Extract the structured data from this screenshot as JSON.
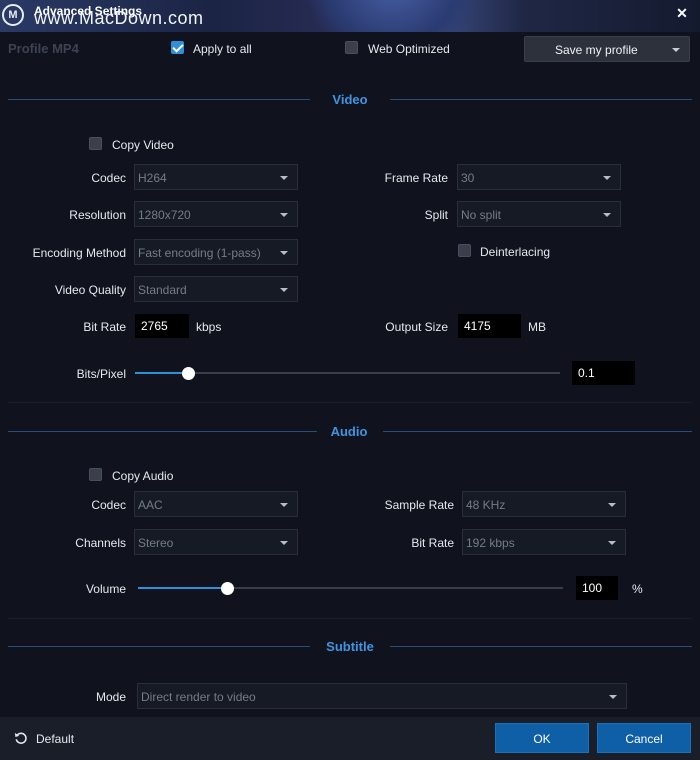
{
  "window": {
    "title": "Advanced Settings",
    "watermark": "www.MacDown.com",
    "logo_letter": "M",
    "close_glyph": "✕"
  },
  "header": {
    "profile_label": "Profile  MP4",
    "apply_to_all": {
      "label": "Apply to all",
      "checked": true
    },
    "web_optimized": {
      "label": "Web Optimized",
      "checked": false
    },
    "save_profile": {
      "label": "Save my profile"
    }
  },
  "video": {
    "title": "Video",
    "copy_video": {
      "label": "Copy Video",
      "checked": false
    },
    "codec": {
      "label": "Codec",
      "value": "H264"
    },
    "frame_rate": {
      "label": "Frame Rate",
      "value": "30"
    },
    "resolution": {
      "label": "Resolution",
      "value": "1280x720"
    },
    "split": {
      "label": "Split",
      "value": "No split"
    },
    "encoding_method": {
      "label": "Encoding Method",
      "value": "Fast encoding (1-pass)"
    },
    "deinterlacing": {
      "label": "Deinterlacing",
      "checked": false
    },
    "video_quality": {
      "label": "Video Quality",
      "value": "Standard"
    },
    "bit_rate": {
      "label": "Bit Rate",
      "value": "2765",
      "unit": "kbps"
    },
    "output_size": {
      "label": "Output Size",
      "value": "4175",
      "unit": "MB"
    },
    "bits_per_pixel": {
      "label": "Bits/Pixel",
      "value": "0.1",
      "slider_fraction": 0.125
    }
  },
  "audio": {
    "title": "Audio",
    "copy_audio": {
      "label": "Copy Audio",
      "checked": false
    },
    "codec": {
      "label": "Codec",
      "value": "AAC"
    },
    "sample_rate": {
      "label": "Sample Rate",
      "value": "48 KHz"
    },
    "channels": {
      "label": "Channels",
      "value": "Stereo"
    },
    "bit_rate": {
      "label": "Bit Rate",
      "value": "192 kbps"
    },
    "volume": {
      "label": "Volume",
      "value": "100",
      "unit": "%",
      "slider_fraction": 0.21
    }
  },
  "subtitle": {
    "title": "Subtitle",
    "mode": {
      "label": "Mode",
      "value": "Direct render to video"
    }
  },
  "footer": {
    "default_label": "Default",
    "ok_label": "OK",
    "cancel_label": "Cancel"
  },
  "colors": {
    "accent": "#2f8fd8",
    "section_title": "#3d95e3",
    "button": "#0f5fa7",
    "background": "#10131d"
  }
}
